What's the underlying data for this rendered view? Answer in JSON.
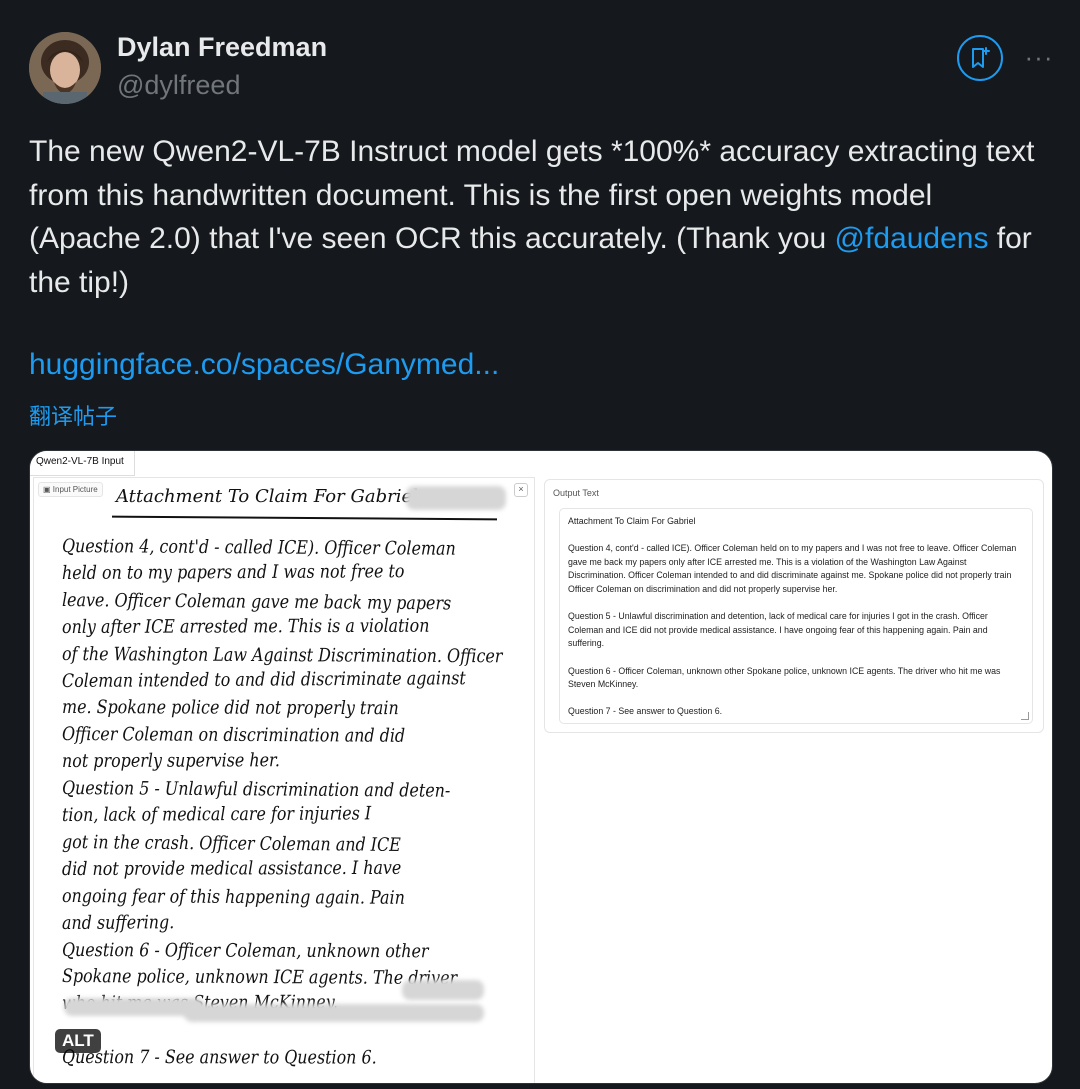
{
  "author": {
    "name": "Dylan Freedman",
    "handle": "@dylfreed",
    "avatar_icon": "profile-photo"
  },
  "actions": {
    "grok_icon": "bookmark-sparkle-icon",
    "more_icon": "more-horizontal-icon",
    "more_label": "···"
  },
  "tweet": {
    "text_part1": "The new Qwen2-VL-7B Instruct model gets *100%* accuracy extracting text from this handwritten document. This is the first open weights model (Apache 2.0) that I've seen OCR this accurately. (Thank you ",
    "mention": "@fdaudens",
    "text_part2": " for the tip!)",
    "link": "huggingface.co/spaces/Ganymed...",
    "translate": "翻译帖子"
  },
  "media": {
    "tab_label": "Qwen2-VL-7B Input",
    "input_label": "Input Picture",
    "close_label": "×",
    "alt_badge": "ALT",
    "handwriting": {
      "title": "Attachment To Claim For Gabriel",
      "lines": [
        "Question 4, cont'd - called ICE). Officer Coleman",
        "held on to my papers and I was not free to",
        "leave. Officer Coleman gave me back my papers",
        "only after ICE arrested me. This is a violation",
        "of the Washington Law Against Discrimination. Officer",
        "Coleman intended to and did discriminate against",
        "me. Spokane police did not properly train",
        "Officer Coleman on discrimination and did",
        "not properly supervise her.",
        "Question 5 - Unlawful discrimination and deten-",
        "tion, lack of medical care for injuries I",
        "got in the crash. Officer Coleman and ICE",
        "did not provide medical assistance. I have",
        "ongoing fear of this happening again. Pain",
        "and suffering.",
        "Question 6 - Officer Coleman, unknown other",
        "Spokane police, unknown ICE agents. The driver",
        "who hit me was Steven McKinney,",
        "",
        "Question 7 - See answer to Question 6."
      ]
    },
    "output": {
      "label": "Output Text",
      "text": "Attachment To Claim For Gabriel\n\nQuestion 4, cont'd - called ICE). Officer Coleman held on to my papers and I was not free to leave. Officer Coleman gave me back my papers only after ICE arrested me. This is a violation of the Washington Law Against Discrimination. Officer Coleman intended to and did discriminate against me. Spokane police did not properly train Officer Coleman on discrimination and did not properly supervise her.\n\nQuestion 5 - Unlawful discrimination and detention, lack of medical care for injuries I got in the crash. Officer Coleman and ICE did not provide medical assistance. I have ongoing fear of this happening again. Pain and suffering.\n\nQuestion 6 - Officer Coleman, unknown other Spokane police, unknown ICE agents. The driver who hit me was Steven McKinney.\n\nQuestion 7 - See answer to Question 6."
    }
  },
  "colors": {
    "background": "#15181c",
    "text": "#e7e9ea",
    "secondary": "#71767b",
    "accent": "#1d9bf0"
  }
}
